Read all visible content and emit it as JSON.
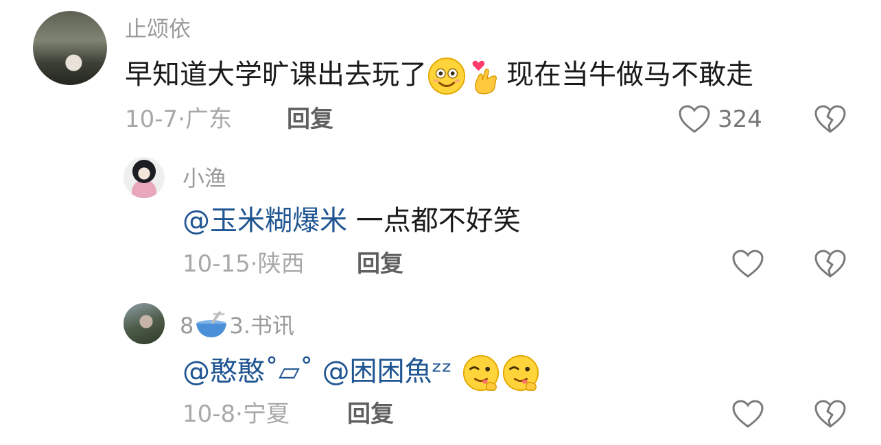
{
  "comments": [
    {
      "username": "止颂依",
      "text": "早知道大学旷课出去玩了",
      "text_after": "现在当牛做马不敢走",
      "emojis": [
        "smiling-face-emoji",
        "finger-heart-emoji"
      ],
      "date": "10-7",
      "location": "广东",
      "reply_label": "回复",
      "likes": "324"
    },
    {
      "username": "小渔",
      "mention": "@玉米糊爆米",
      "text": "一点都不好笑",
      "date": "10-15",
      "location": "陕西",
      "reply_label": "回复"
    },
    {
      "username_prefix": "8",
      "username_suffix": "3.书讯",
      "username_emoji": "bowl-spoon-emoji",
      "mention1": "@憨憨˚▱˚",
      "mention2": "@困困魚ᶻᶻ",
      "emojis": [
        "yummy-face-emoji",
        "yummy-face-emoji"
      ],
      "date": "10-8",
      "location": "宁夏",
      "reply_label": "回复"
    }
  ],
  "meta_separator": "·",
  "colors": {
    "mention": "#1f5591",
    "muted": "#a8a8a8"
  }
}
